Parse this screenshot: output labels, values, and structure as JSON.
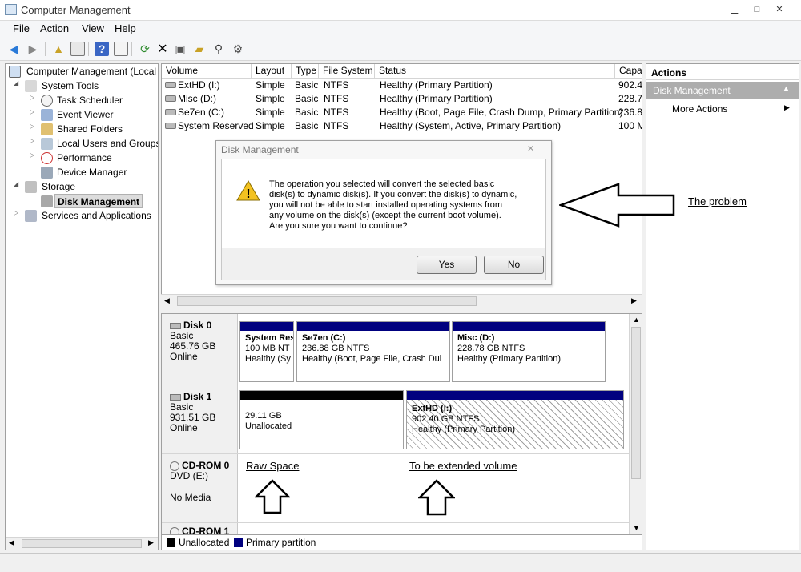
{
  "window": {
    "title": "Computer Management",
    "min_icon": "minimize-icon",
    "max_icon": "maximize-icon",
    "close_icon": "close-icon"
  },
  "menu": {
    "file": "File",
    "action": "Action",
    "view": "View",
    "help": "Help"
  },
  "toolbar_icons": [
    "back-icon",
    "forward-icon",
    "up-folder-icon",
    "show-hide-tree-icon",
    "help-icon",
    "properties-icon",
    "refresh-icon",
    "delete-icon",
    "disk-properties-icon",
    "open-icon",
    "search-icon",
    "settings-icon"
  ],
  "tree": {
    "root": "Computer Management (Local",
    "system_tools": "System Tools",
    "task_scheduler": "Task Scheduler",
    "event_viewer": "Event Viewer",
    "shared_folders": "Shared Folders",
    "local_users": "Local Users and Groups",
    "performance": "Performance",
    "device_manager": "Device Manager",
    "storage": "Storage",
    "disk_management": "Disk Management",
    "services": "Services and Applications"
  },
  "volume_table": {
    "headers": [
      "Volume",
      "Layout",
      "Type",
      "File System",
      "Status",
      "Capac"
    ],
    "rows": [
      {
        "volume": "ExtHD (I:)",
        "layout": "Simple",
        "type": "Basic",
        "fs": "NTFS",
        "status": "Healthy (Primary Partition)",
        "capacity": "902.4"
      },
      {
        "volume": "Misc (D:)",
        "layout": "Simple",
        "type": "Basic",
        "fs": "NTFS",
        "status": "Healthy (Primary Partition)",
        "capacity": "228.7"
      },
      {
        "volume": "Se7en (C:)",
        "layout": "Simple",
        "type": "Basic",
        "fs": "NTFS",
        "status": "Healthy (Boot, Page File, Crash Dump, Primary Partition)",
        "capacity": "236.8"
      },
      {
        "volume": "System Reserved",
        "layout": "Simple",
        "type": "Basic",
        "fs": "NTFS",
        "status": "Healthy (System, Active, Primary Partition)",
        "capacity": "100 M"
      }
    ]
  },
  "disks": {
    "disk0": {
      "name": "Disk 0",
      "type": "Basic",
      "size": "465.76 GB",
      "state": "Online",
      "p1": {
        "name": "System Res",
        "size": "100 MB NT",
        "status": "Healthy (Sy"
      },
      "p2": {
        "name": "Se7en  (C:)",
        "size": "236.88 GB NTFS",
        "status": "Healthy (Boot, Page File, Crash Dui"
      },
      "p3": {
        "name": "Misc  (D:)",
        "size": "228.78 GB NTFS",
        "status": "Healthy (Primary Partition)"
      }
    },
    "disk1": {
      "name": "Disk 1",
      "type": "Basic",
      "size": "931.51 GB",
      "state": "Online",
      "p1": {
        "size": "29.11 GB",
        "status": "Unallocated"
      },
      "p2": {
        "name": "ExtHD  (I:)",
        "size": "902.40 GB NTFS",
        "status": "Healthy (Primary Partition)"
      }
    },
    "cdrom0": {
      "name": "CD-ROM 0",
      "type": "DVD (E:)",
      "state": "No Media"
    },
    "cdrom1": {
      "name": "CD-ROM 1"
    }
  },
  "legend": {
    "unallocated": "Unallocated",
    "primary": "Primary partition"
  },
  "colors": {
    "unallocated": "#000000",
    "primary": "#00007f",
    "selection": "#3399ff"
  },
  "actions": {
    "header": "Actions",
    "section": "Disk Management",
    "more": "More Actions"
  },
  "dialog": {
    "title": "Disk Management",
    "line1": "The operation you selected will convert the selected basic",
    "line2": "disk(s) to dynamic disk(s). If you convert the disk(s) to dynamic,",
    "line3": "you will not be able to start installed operating systems from",
    "line4": "any volume on the disk(s) (except the current boot volume).",
    "line5": "Are you sure you want to continue?",
    "yes": "Yes",
    "no": "No"
  },
  "annotations": {
    "problem": "The problem",
    "raw": "Raw Space",
    "extended": "To be extended volume"
  }
}
